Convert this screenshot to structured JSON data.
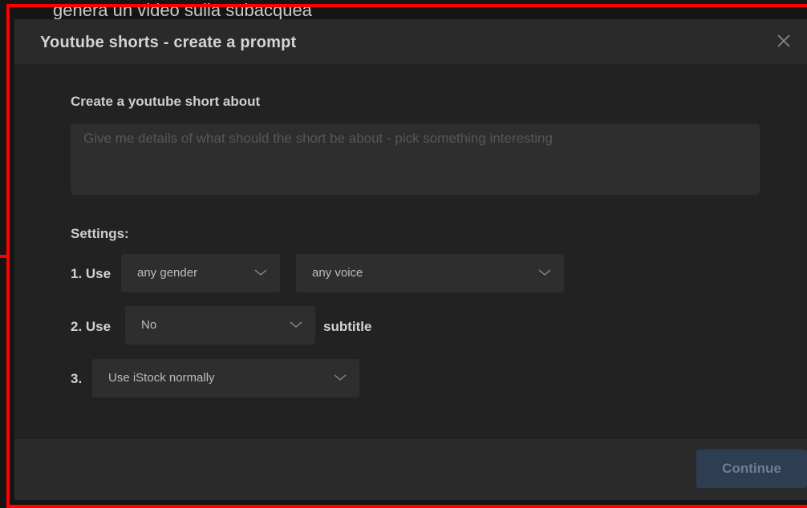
{
  "background": {
    "partial_text": "genera un video sulla subacquea"
  },
  "modal": {
    "title": "Youtube shorts - create a prompt",
    "prompt_label": "Create a youtube short about",
    "prompt_placeholder": "Give me details of what should the short be about - pick something interesting",
    "prompt_value": "",
    "settings_label": "Settings:",
    "row1": {
      "label": "1. Use",
      "gender_select": "any gender",
      "voice_select": "any voice"
    },
    "row2": {
      "label": "2. Use",
      "subtitle_select": "No",
      "suffix": "subtitle"
    },
    "row3": {
      "label": "3.",
      "istock_select": "Use iStock normally"
    },
    "continue_label": "Continue"
  },
  "colors": {
    "highlight_border": "#ff0000",
    "accent_button": "#2d3d52"
  }
}
